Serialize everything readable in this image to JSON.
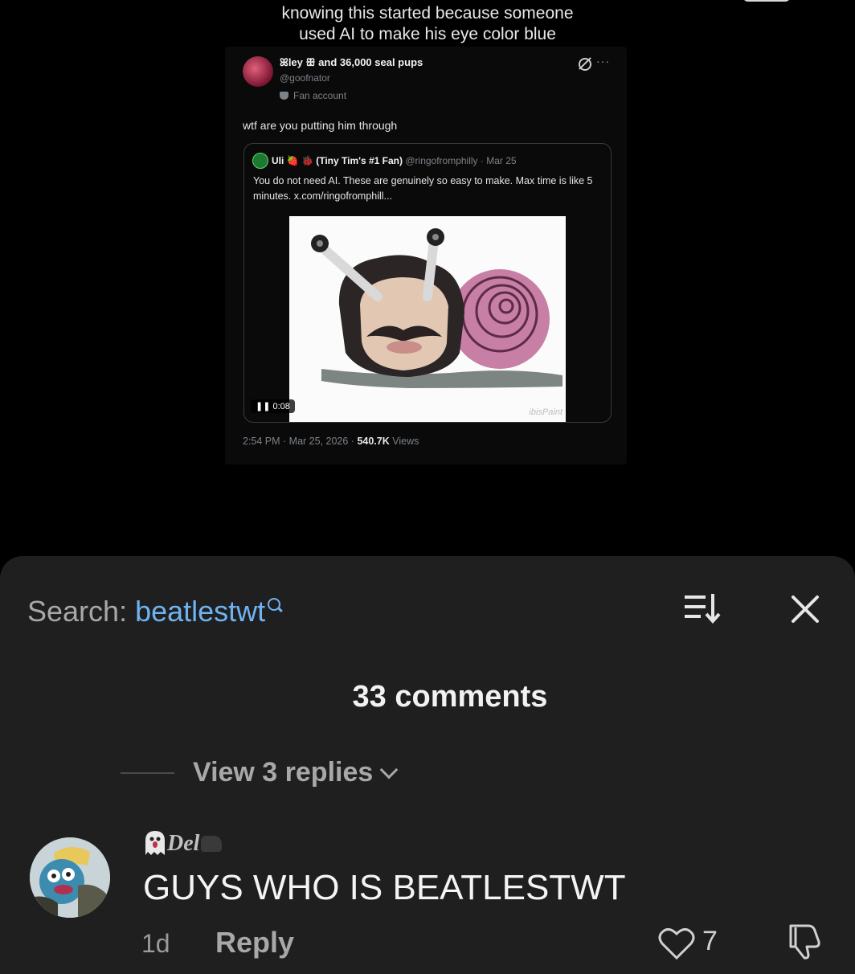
{
  "video": {
    "caption_line1": "knowing this started because someone",
    "caption_line2": "used AI to make his eye color blue",
    "tweet": {
      "display_name": "ꕤley ꕥ and 36,000 seal pups",
      "handle": "@goofnator",
      "label": "Fan account",
      "text": "wtf are you putting him through",
      "quote": {
        "name": "Uli 🍓 🐞 (Tiny Tim's #1 Fan)",
        "meta": "@ringofromphilly · Mar 25",
        "text": "You do not need AI. These are genuinely so easy to make. Max time is like 5 minutes. x.com/ringofromphill...",
        "duration": "❚❚  0:08",
        "watermark": "ibisPaint"
      },
      "time_date": "2:54 PM · Mar 25, 2026 · ",
      "views_count": "540.7K",
      "views_label": " Views"
    }
  },
  "comments_sheet": {
    "search_label": "Search: ",
    "search_term": "beatlestwt",
    "comment_count": "33 comments",
    "view_replies": "View 3 replies",
    "comment": {
      "author": "Del",
      "text": "GUYS WHO IS BEATLESTWT",
      "age": "1d",
      "reply_label": "Reply",
      "likes": "7"
    }
  },
  "colors": {
    "background": "#000000",
    "sheet": "#1f1f1f",
    "accent_link": "#6fb3f2",
    "muted": "#a8a8a8"
  }
}
